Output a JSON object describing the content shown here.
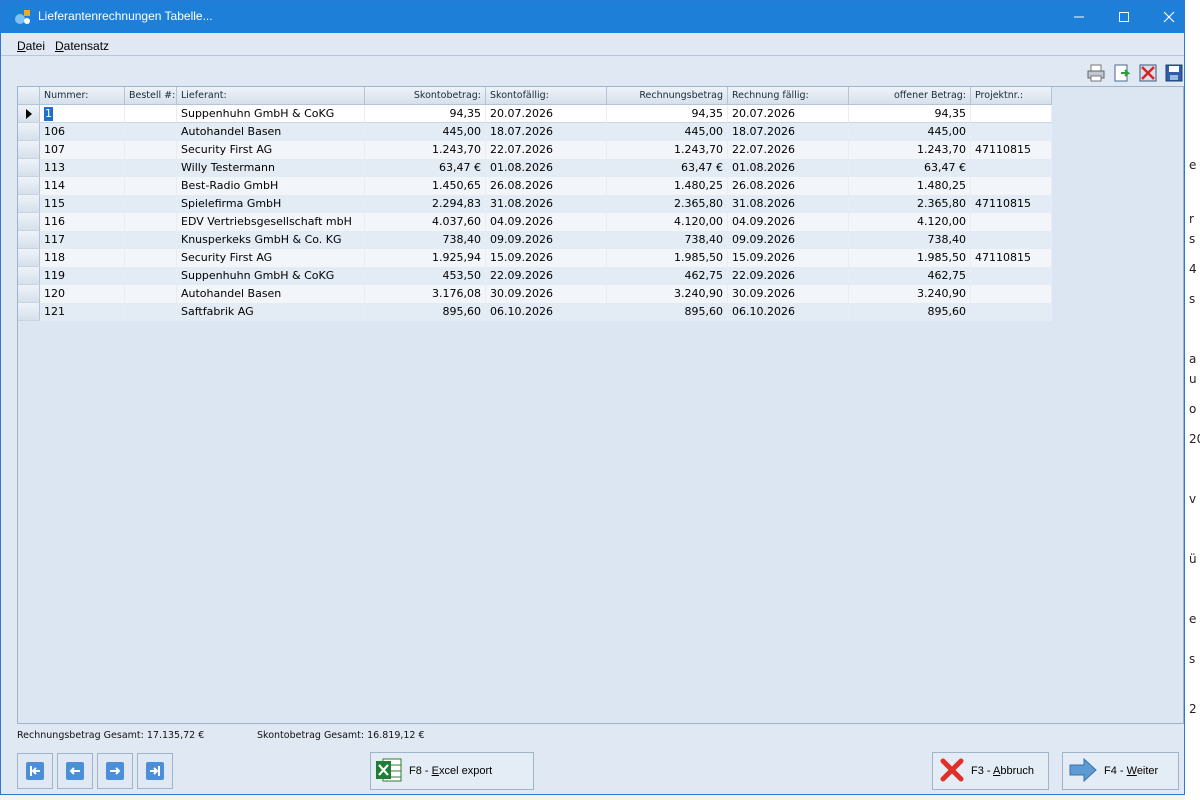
{
  "window": {
    "title": "Lieferantenrechnungen Tabelle...",
    "accent_color": "#1e7fd8",
    "icons": [
      "app-icon",
      "minimize-icon",
      "maximize-icon",
      "close-icon"
    ]
  },
  "menu": {
    "items": [
      {
        "label": "Datei",
        "accel": "D",
        "rest": "atei"
      },
      {
        "label": "Datensatz",
        "accel": "D",
        "rest": "atensatz"
      }
    ]
  },
  "toolbar": {
    "icons": [
      "print-icon",
      "export-icon",
      "delete-icon",
      "save-icon"
    ]
  },
  "table": {
    "columns": [
      "Nummer:",
      "Bestell #:",
      "Lieferant:",
      "Skontobetrag:",
      "Skontofällig:",
      "Rechnungsbetrag",
      "Rechnung fällig:",
      "offener Betrag:",
      "Projektnr.:"
    ],
    "rows": [
      {
        "nummer": "1",
        "bestell": "",
        "lieferant": "Suppenhuhn GmbH & CoKG",
        "skontobetrag": "94,35",
        "skontofaellig": "20.07.2026",
        "rechnungsbetrag": "94,35",
        "rechnung_faellig": "20.07.2026",
        "offener_betrag": "94,35",
        "projektnr": ""
      },
      {
        "nummer": "106",
        "bestell": "",
        "lieferant": "Autohandel Basen",
        "skontobetrag": "445,00",
        "skontofaellig": "18.07.2026",
        "rechnungsbetrag": "445,00",
        "rechnung_faellig": "18.07.2026",
        "offener_betrag": "445,00",
        "projektnr": ""
      },
      {
        "nummer": "107",
        "bestell": "",
        "lieferant": "Security First AG",
        "skontobetrag": "1.243,70",
        "skontofaellig": "22.07.2026",
        "rechnungsbetrag": "1.243,70",
        "rechnung_faellig": "22.07.2026",
        "offener_betrag": "1.243,70",
        "projektnr": "47110815"
      },
      {
        "nummer": "113",
        "bestell": "",
        "lieferant": "Willy Testermann",
        "skontobetrag": "63,47 €",
        "skontofaellig": "01.08.2026",
        "rechnungsbetrag": "63,47 €",
        "rechnung_faellig": "01.08.2026",
        "offener_betrag": "63,47 €",
        "projektnr": ""
      },
      {
        "nummer": "114",
        "bestell": "",
        "lieferant": "Best-Radio GmbH",
        "skontobetrag": "1.450,65",
        "skontofaellig": "26.08.2026",
        "rechnungsbetrag": "1.480,25",
        "rechnung_faellig": "26.08.2026",
        "offener_betrag": "1.480,25",
        "projektnr": ""
      },
      {
        "nummer": "115",
        "bestell": "",
        "lieferant": "Spielefirma GmbH",
        "skontobetrag": "2.294,83",
        "skontofaellig": "31.08.2026",
        "rechnungsbetrag": "2.365,80",
        "rechnung_faellig": "31.08.2026",
        "offener_betrag": "2.365,80",
        "projektnr": "47110815"
      },
      {
        "nummer": "116",
        "bestell": "",
        "lieferant": "EDV Vertriebsgesellschaft mbH",
        "skontobetrag": "4.037,60",
        "skontofaellig": "04.09.2026",
        "rechnungsbetrag": "4.120,00",
        "rechnung_faellig": "04.09.2026",
        "offener_betrag": "4.120,00",
        "projektnr": ""
      },
      {
        "nummer": "117",
        "bestell": "",
        "lieferant": "Knusperkeks GmbH & Co. KG",
        "skontobetrag": "738,40",
        "skontofaellig": "09.09.2026",
        "rechnungsbetrag": "738,40",
        "rechnung_faellig": "09.09.2026",
        "offener_betrag": "738,40",
        "projektnr": ""
      },
      {
        "nummer": "118",
        "bestell": "",
        "lieferant": "Security First AG",
        "skontobetrag": "1.925,94",
        "skontofaellig": "15.09.2026",
        "rechnungsbetrag": "1.985,50",
        "rechnung_faellig": "15.09.2026",
        "offener_betrag": "1.985,50",
        "projektnr": "47110815"
      },
      {
        "nummer": "119",
        "bestell": "",
        "lieferant": "Suppenhuhn GmbH & CoKG",
        "skontobetrag": "453,50",
        "skontofaellig": "22.09.2026",
        "rechnungsbetrag": "462,75",
        "rechnung_faellig": "22.09.2026",
        "offener_betrag": "462,75",
        "projektnr": ""
      },
      {
        "nummer": "120",
        "bestell": "",
        "lieferant": "Autohandel Basen",
        "skontobetrag": "3.176,08",
        "skontofaellig": "30.09.2026",
        "rechnungsbetrag": "3.240,90",
        "rechnung_faellig": "30.09.2026",
        "offener_betrag": "3.240,90",
        "projektnr": ""
      },
      {
        "nummer": "121",
        "bestell": "",
        "lieferant": "Saftfabrik AG",
        "skontobetrag": "895,60",
        "skontofaellig": "06.10.2026",
        "rechnungsbetrag": "895,60",
        "rechnung_faellig": "06.10.2026",
        "offener_betrag": "895,60",
        "projektnr": ""
      }
    ]
  },
  "totals": {
    "rechnungsbetrag": "Rechnungsbetrag Gesamt: 17.135,72 €",
    "skontobetrag": "Skontobetrag Gesamt: 16.819,12 €"
  },
  "nav": {
    "icons": [
      "first-record-icon",
      "previous-record-icon",
      "next-record-icon",
      "last-record-icon"
    ]
  },
  "buttons": {
    "excel": {
      "label": "F8 - Excel export",
      "prefix": "F8 - ",
      "accel": "E",
      "rest": "xcel export"
    },
    "cancel": {
      "label": "F3 - Abbruch",
      "prefix": "F3 - ",
      "accel": "A",
      "rest": "bbruch"
    },
    "next": {
      "label": "F4 - Weiter",
      "prefix": "F4 - ",
      "accel": "W",
      "rest": "eiter"
    }
  },
  "background_fragments": [
    "e",
    "r",
    "s",
    "4",
    "s",
    "a",
    "u",
    "o",
    "20",
    "v",
    "ü",
    "e",
    "s",
    "2"
  ]
}
